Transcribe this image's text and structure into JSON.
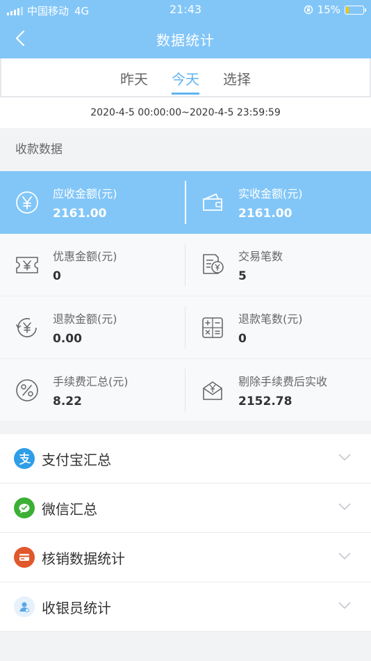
{
  "status_bar": {
    "carrier": "中国移动",
    "network": "4G",
    "time": "21:43",
    "battery": "15%",
    "battery_level": 0.15
  },
  "nav": {
    "title": "数据统计"
  },
  "tabs": [
    {
      "label": "昨天"
    },
    {
      "label": "今天"
    },
    {
      "label": "选择"
    }
  ],
  "active_tab": "今天",
  "date_range": "2020-4-5 00:00:00~2020-4-5 23:59:59",
  "section": {
    "title": "收款数据"
  },
  "stats": [
    {
      "label": "应收金额(元)",
      "value": "2161.00",
      "icon": "yen-circle-icon"
    },
    {
      "label": "实收金额(元)",
      "value": "2161.00",
      "icon": "wallet-icon"
    },
    {
      "label": "优惠金额(元)",
      "value": "0",
      "icon": "coupon-icon"
    },
    {
      "label": "交易笔数",
      "value": "5",
      "icon": "receipt-icon"
    },
    {
      "label": "退款金额(元)",
      "value": "0.00",
      "icon": "refund-icon"
    },
    {
      "label": "退款笔数(元)",
      "value": "0",
      "icon": "calculator-icon"
    },
    {
      "label": "手续费汇总(元)",
      "value": "8.22",
      "icon": "percent-icon"
    },
    {
      "label": "剔除手续费后实收",
      "value": "2152.78",
      "icon": "envelope-icon"
    }
  ],
  "summary_list": [
    {
      "label": "支付宝汇总",
      "icon": "alipay-icon",
      "color": "#2f9ee8"
    },
    {
      "label": "微信汇总",
      "icon": "wechat-icon",
      "color": "#3cb034"
    },
    {
      "label": "核销数据统计",
      "icon": "card-icon",
      "color": "#e0582c"
    },
    {
      "label": "收银员统计",
      "icon": "cashier-icon",
      "color": "#5aa7e8"
    }
  ]
}
